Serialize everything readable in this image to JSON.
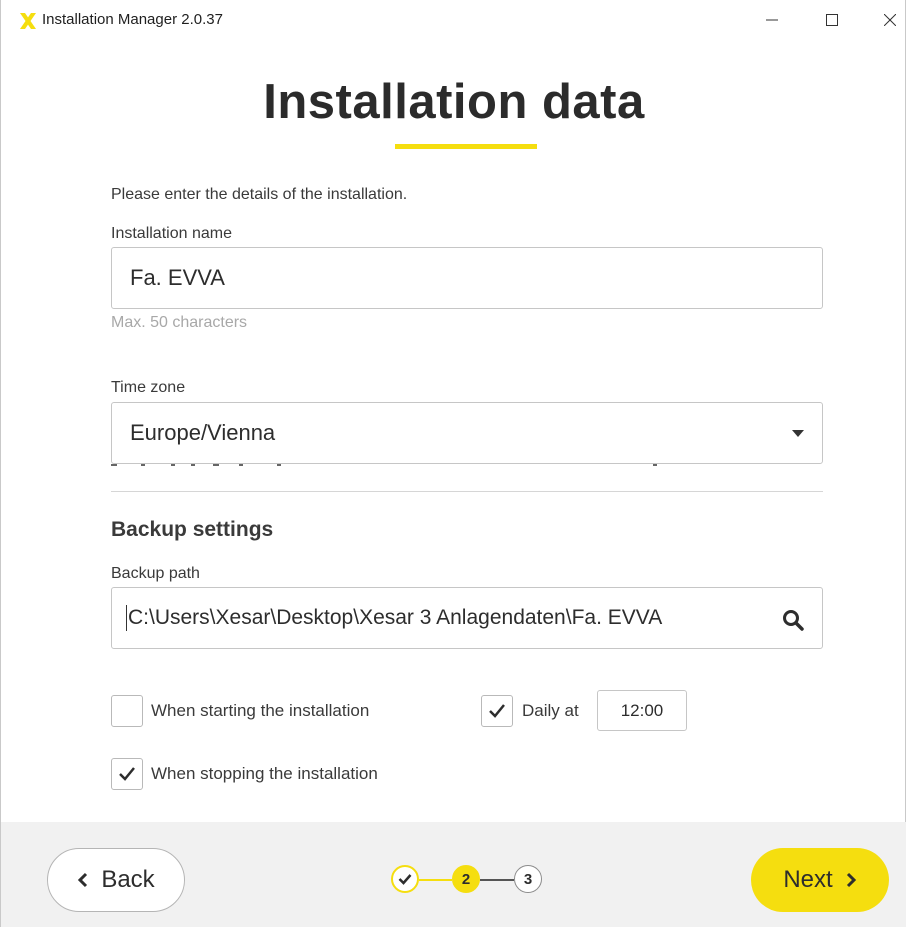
{
  "window": {
    "title": "Installation Manager 2.0.37",
    "accent_color": "#f5de0f"
  },
  "page": {
    "title": "Installation data",
    "intro": "Please enter the details of the installation."
  },
  "installation_name": {
    "label": "Installation name",
    "value": "Fa. EVVA",
    "hint": "Max. 50 characters"
  },
  "time_zone": {
    "label": "Time zone",
    "value": "Europe/Vienna"
  },
  "backup": {
    "section_title": "Backup settings",
    "path_label": "Backup path",
    "path_value": "C:\\Users\\Xesar\\Desktop\\Xesar 3 Anlagendaten\\Fa. EVVA",
    "on_start": {
      "label": "When starting the installation",
      "checked": false
    },
    "daily": {
      "label": "Daily at",
      "checked": true,
      "time": "12:00"
    },
    "on_stop": {
      "label": "When stopping the installation",
      "checked": true
    }
  },
  "footer": {
    "back_label": "Back",
    "next_label": "Next",
    "steps": [
      {
        "label": "",
        "state": "done"
      },
      {
        "label": "2",
        "state": "active"
      },
      {
        "label": "3",
        "state": "pending"
      }
    ]
  },
  "icons": [
    "app-logo-icon",
    "minimize-icon",
    "maximize-icon",
    "close-icon",
    "dropdown-arrow-icon",
    "search-icon",
    "checkmark-icon",
    "chevron-left-icon",
    "chevron-right-icon"
  ]
}
